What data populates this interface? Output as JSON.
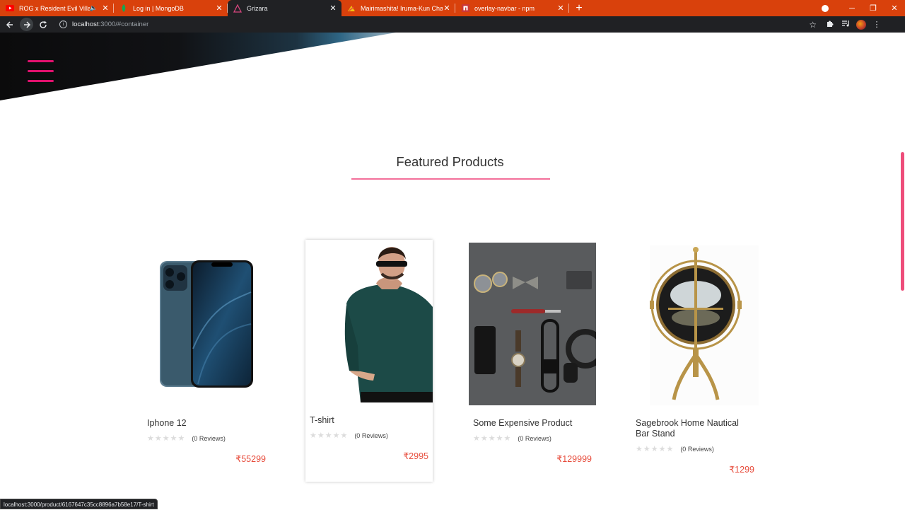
{
  "browser": {
    "tabs": [
      {
        "title": "ROG x Resident Evil Village |",
        "muted_icon": "🔈",
        "favicon": "youtube-icon"
      },
      {
        "title": "Log in | MongoDB",
        "favicon": "mongodb-leaf-icon"
      },
      {
        "title": "Grizara",
        "favicon": "triangle-icon",
        "active": true
      },
      {
        "title": "Mairimashita! Iruma-Kun Chapte",
        "favicon": "manga-icon"
      },
      {
        "title": "overlay-navbar - npm",
        "favicon": "npm-icon"
      }
    ],
    "new_tab": "+",
    "address": {
      "host": "localhost",
      "path": ":3000/#container"
    },
    "window_controls": {
      "minimize": "─",
      "restore": "❐",
      "close": "✕"
    }
  },
  "page": {
    "accent_color": "#e0116d",
    "section_title": "Featured Products",
    "products": [
      {
        "name": "Iphone 12",
        "stars": "★★★★★",
        "reviews": "(0 Reviews)",
        "price": "₹55299",
        "rating": 0
      },
      {
        "name": "T-shirt",
        "stars": "★★★★★",
        "reviews": "(0 Reviews)",
        "price": "₹2995",
        "rating": 0
      },
      {
        "name": "Some Expensive Product",
        "stars": "★★★★★",
        "reviews": "(0 Reviews)",
        "price": "₹129999",
        "rating": 0
      },
      {
        "name": "Sagebrook Home Nautical Bar Stand",
        "stars": "★★★★★",
        "reviews": "(0 Reviews)",
        "price": "₹1299",
        "rating": 0
      }
    ]
  },
  "status_bar": {
    "url": "localhost:3000/product/6167647c35cc8896a7b58e17/T-shirt"
  }
}
